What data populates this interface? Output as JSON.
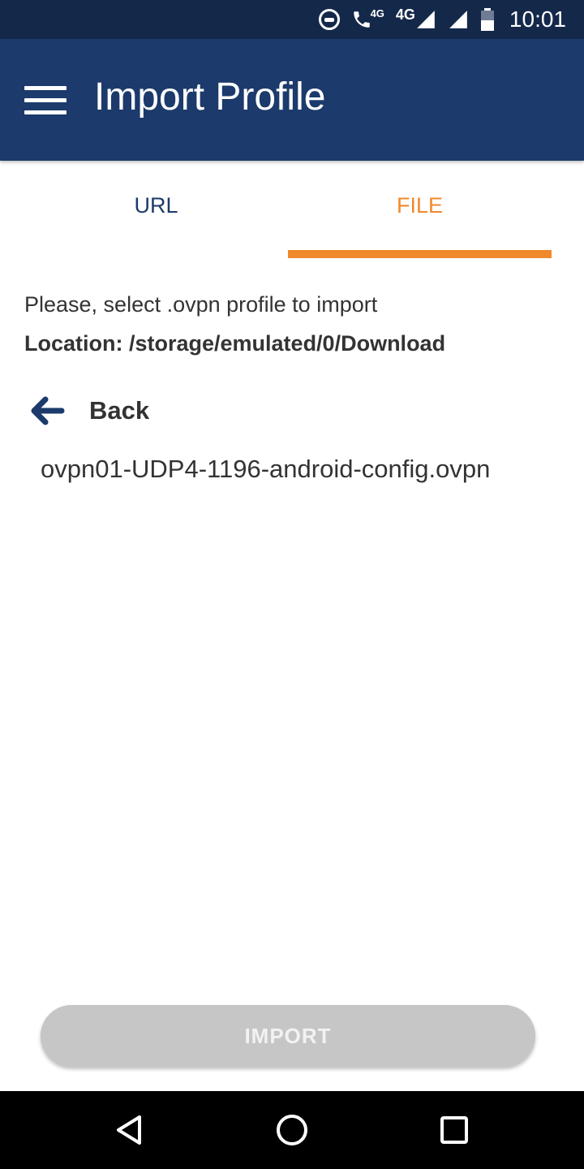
{
  "status_bar": {
    "call_network": "4G",
    "network": "4G",
    "time": "10:01"
  },
  "app_bar": {
    "title": "Import Profile"
  },
  "tabs": [
    {
      "label": "URL",
      "selected": false
    },
    {
      "label": "FILE",
      "selected": true
    }
  ],
  "content": {
    "prompt": "Please, select .ovpn profile to import",
    "location": "Location: /storage/emulated/0/Download",
    "back_label": "Back",
    "files": [
      "ovpn01-UDP4-1196-android-config.ovpn"
    ]
  },
  "import_button": {
    "label": "IMPORT",
    "enabled": false
  },
  "icons": [
    "menu-icon",
    "arrow-left-icon",
    "dnd-icon",
    "wifi-call-icon",
    "signal-icon",
    "battery-icon",
    "nav-back-icon",
    "nav-home-icon",
    "nav-recent-icon"
  ],
  "colors": {
    "status_bar": "#14284a",
    "app_bar": "#1c3a6b",
    "accent": "#f0892b",
    "button_disabled": "#c6c6c6"
  }
}
